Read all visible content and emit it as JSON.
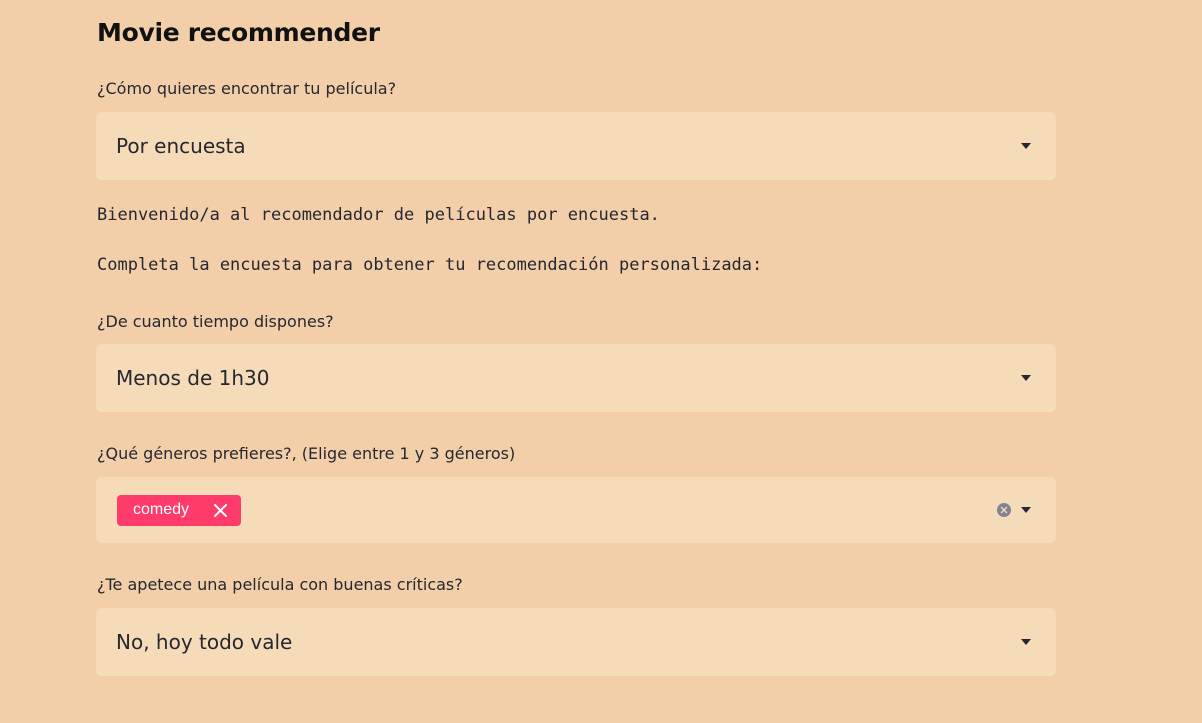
{
  "app": {
    "title": "Movie recommender"
  },
  "search_mode": {
    "label": "¿Cómo quieres encontrar tu película?",
    "value": "Por encuesta"
  },
  "intro": {
    "welcome": "Bienvenido/a al recomendador de películas por encuesta.",
    "instructions": "Completa la encuesta para obtener tu recomendación personalizada:"
  },
  "time_question": {
    "label": "¿De cuanto tiempo dispones?",
    "value": "Menos de 1h30"
  },
  "genres_question": {
    "label": "¿Qué géneros prefieres?, (Elige entre 1 y 3 géneros)",
    "selected": [
      "comedy"
    ]
  },
  "reviews_question": {
    "label": "¿Te apetece una película con buenas críticas?",
    "value": "No, hoy todo vale"
  },
  "icons": {
    "chevron": "chevron-down-icon",
    "remove_tag": "close-icon",
    "clear": "clear-circle-icon"
  },
  "colors": {
    "background": "#f2cfa8",
    "input_background": "#f5dbb8",
    "tag": "#ff3b6b",
    "text": "#262730"
  }
}
